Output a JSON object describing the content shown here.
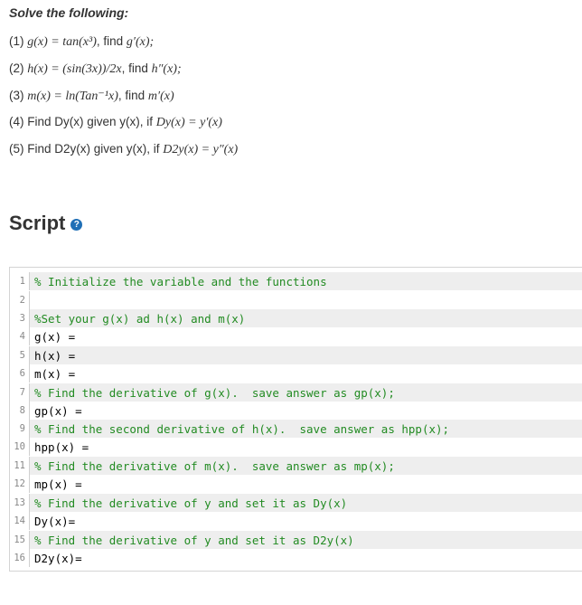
{
  "prompt": {
    "title": "Solve the following:",
    "problems": [
      {
        "num": "(1)",
        "math": "g(x) = tan(x³)",
        "text": ", find ",
        "target": "g′(x);"
      },
      {
        "num": "(2)",
        "math": "h(x) = (sin(3x))/2x",
        "text": ", find ",
        "target": "h″(x);"
      },
      {
        "num": "(3)",
        "math": "m(x) = ln(Tan⁻¹x)",
        "text": ", find ",
        "target": "m′(x)"
      },
      {
        "num": "(4)",
        "pre": "Find Dy(x) given y(x), if ",
        "math": "Dy(x) = y′(x)"
      },
      {
        "num": "(5)",
        "pre": "Find D2y(x) given y(x), if ",
        "math": "D2y(x) = y″(x)"
      }
    ]
  },
  "script": {
    "heading": "Script",
    "help_icon": "question-circle-icon",
    "lines": [
      {
        "n": "1",
        "text": "% Initialize the variable and the functions",
        "kind": "comment"
      },
      {
        "n": "2",
        "text": "",
        "kind": "plain"
      },
      {
        "n": "3",
        "text": "%Set your g(x) ad h(x) and m(x)",
        "kind": "comment"
      },
      {
        "n": "4",
        "text": "g(x) =",
        "kind": "plain"
      },
      {
        "n": "5",
        "text": "h(x) =",
        "kind": "plain"
      },
      {
        "n": "6",
        "text": "m(x) =",
        "kind": "plain"
      },
      {
        "n": "7",
        "text": "% Find the derivative of g(x).  save answer as gp(x);",
        "kind": "comment"
      },
      {
        "n": "8",
        "text": "gp(x) =",
        "kind": "plain"
      },
      {
        "n": "9",
        "text": "% Find the second derivative of h(x).  save answer as hpp(x);",
        "kind": "comment"
      },
      {
        "n": "10",
        "text": "hpp(x) =",
        "kind": "plain"
      },
      {
        "n": "11",
        "text": "% Find the derivative of m(x).  save answer as mp(x);",
        "kind": "comment"
      },
      {
        "n": "12",
        "text": "mp(x) =",
        "kind": "plain"
      },
      {
        "n": "13",
        "text": "% Find the derivative of y and set it as Dy(x)",
        "kind": "comment"
      },
      {
        "n": "14",
        "text": "Dy(x)=",
        "kind": "plain"
      },
      {
        "n": "15",
        "text": "% Find the derivative of y and set it as D2y(x)",
        "kind": "comment"
      },
      {
        "n": "16",
        "text": "D2y(x)=",
        "kind": "plain"
      }
    ]
  },
  "colors": {
    "comment": "#228B22",
    "help_icon": "#1f6fb6",
    "shaded_line": "#eeeeee"
  }
}
